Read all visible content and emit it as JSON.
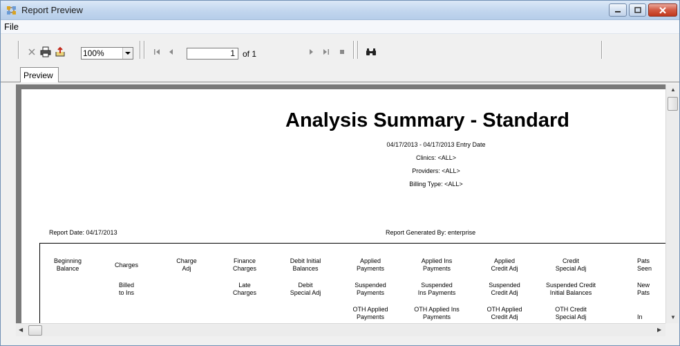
{
  "window": {
    "title": "Report Preview"
  },
  "menu": {
    "file": "File"
  },
  "toolbar": {
    "zoom": "100%",
    "page_current": "1",
    "page_of": "of 1"
  },
  "tabs": {
    "preview": "Preview"
  },
  "report": {
    "title": "Analysis Summary - Standard",
    "subtitle_lines": [
      "04/17/2013 - 04/17/2013 Entry Date",
      "Clinics: <ALL>",
      "Providers: <ALL>",
      "Billing Type: <ALL>"
    ],
    "report_date": "Report Date: 04/17/2013",
    "generated_by": "Report Generated By: enterprise",
    "columns": [
      {
        "row1": [
          "Beginning",
          "Balance"
        ]
      },
      {
        "row1": [
          "Charges"
        ],
        "row2": [
          "Billed",
          "to Ins"
        ]
      },
      {
        "row1": [
          "Charge",
          "Adj"
        ]
      },
      {
        "row1": [
          "Finance",
          "Charges"
        ],
        "row2": [
          "Late",
          "Charges"
        ]
      },
      {
        "row1": [
          "Debit Initial",
          "Balances"
        ],
        "row2": [
          "Debit",
          "Special Adj"
        ]
      },
      {
        "row1": [
          "Applied",
          "Payments"
        ],
        "row2": [
          "Suspended",
          "Payments"
        ],
        "row3": [
          "OTH Applied",
          "Payments"
        ]
      },
      {
        "row1": [
          "Applied Ins",
          "Payments"
        ],
        "row2": [
          "Suspended",
          "Ins Payments"
        ],
        "row3": [
          "OTH Applied Ins",
          "Payments"
        ]
      },
      {
        "row1": [
          "Applied",
          "Credit Adj"
        ],
        "row2": [
          "Suspended",
          "Credit Adj"
        ],
        "row3": [
          "OTH Applied",
          "Credit Adj"
        ]
      },
      {
        "row1": [
          "Credit",
          "Special Adj"
        ],
        "row2": [
          "Suspended Credit",
          "Initial Balances"
        ],
        "row3": [
          "OTH Credit",
          "Special Adj"
        ]
      },
      {
        "row1": [
          "Pats",
          "Seen"
        ],
        "row2": [
          "New",
          "Pats"
        ],
        "row3": [
          "",
          "In"
        ]
      }
    ]
  },
  "icons": [
    "app-icon",
    "minimize-icon",
    "maximize-icon",
    "close-icon",
    "stop-icon",
    "print-icon",
    "export-icon",
    "dropdown-icon",
    "first-page-icon",
    "prev-page-icon",
    "next-page-icon",
    "last-page-icon",
    "stop-load-icon",
    "find-icon"
  ]
}
